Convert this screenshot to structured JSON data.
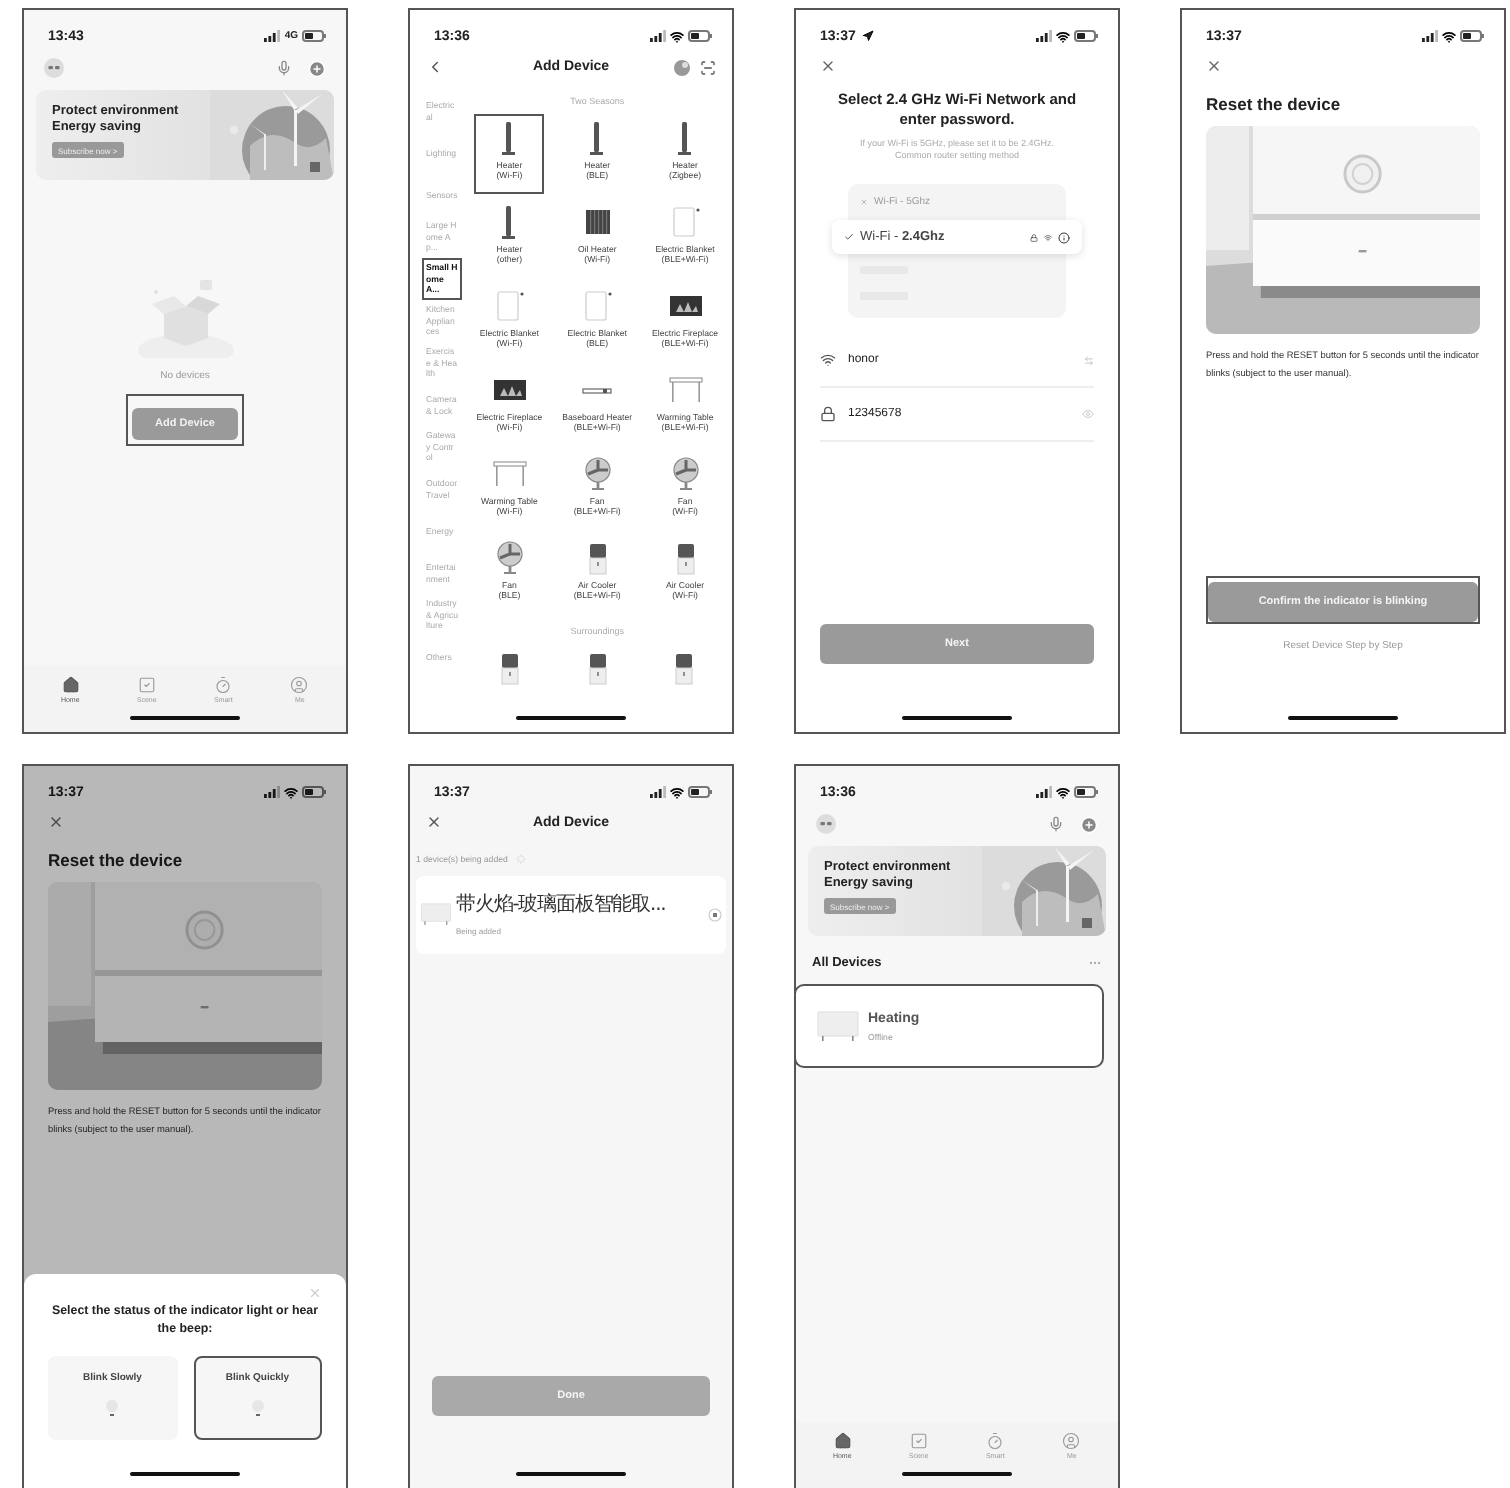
{
  "screens": [
    {
      "kind": "home_empty",
      "time": "13:43",
      "network": "4G",
      "banner": {
        "title": "Protect environment",
        "subtitle": "Energy saving",
        "button": "Subscribe now >"
      },
      "empty_text": "No devices",
      "add_button": {
        "label": "Add Device",
        "highlighted": true
      },
      "tabs": [
        {
          "label": "Home",
          "selected": true
        },
        {
          "label": "Scene",
          "selected": false
        },
        {
          "label": "Smart",
          "selected": false
        },
        {
          "label": "Me",
          "selected": false
        }
      ]
    },
    {
      "kind": "catalog",
      "time": "13:36",
      "title": "Add Device",
      "categories": [
        {
          "label": "Electrical",
          "selected": false
        },
        {
          "label": "Lighting",
          "selected": false
        },
        {
          "label": "Sensors",
          "selected": false
        },
        {
          "label": "Large Home Ap...",
          "selected": false
        },
        {
          "label": "Small Home A...",
          "selected": true
        },
        {
          "label": "Kitchen Appliances",
          "selected": false
        },
        {
          "label": "Exercise & Health",
          "selected": false
        },
        {
          "label": "Camera & Lock",
          "selected": false
        },
        {
          "label": "Gateway Control",
          "selected": false
        },
        {
          "label": "Outdoor Travel",
          "selected": false
        },
        {
          "label": "Energy",
          "selected": false
        },
        {
          "label": "Entertainment",
          "selected": false
        },
        {
          "label": "Industry & Agriculture",
          "selected": false
        },
        {
          "label": "Others",
          "selected": false
        }
      ],
      "sections": [
        {
          "heading": "Two Seasons",
          "items": [
            {
              "name": "Heater",
              "protocol": "(Wi-Fi)",
              "kind": "tower",
              "highlighted": true
            },
            {
              "name": "Heater",
              "protocol": "(BLE)",
              "kind": "tower",
              "highlighted": false
            },
            {
              "name": "Heater",
              "protocol": "(Zigbee)",
              "kind": "tower",
              "highlighted": false
            },
            {
              "name": "Heater",
              "protocol": "(other)",
              "kind": "tower",
              "highlighted": false
            },
            {
              "name": "Oil Heater",
              "protocol": "(Wi-Fi)",
              "kind": "radiator",
              "highlighted": false
            },
            {
              "name": "Electric Blanket",
              "protocol": "(BLE+Wi-Fi)",
              "kind": "blanket",
              "highlighted": false
            },
            {
              "name": "Electric Blanket",
              "protocol": "(Wi-Fi)",
              "kind": "blanket",
              "highlighted": false
            },
            {
              "name": "Electric Blanket",
              "protocol": "(BLE)",
              "kind": "blanket",
              "highlighted": false
            },
            {
              "name": "Electric Fireplace",
              "protocol": "(BLE+Wi-Fi)",
              "kind": "fireplace",
              "highlighted": false
            },
            {
              "name": "Electric Fireplace",
              "protocol": "(Wi-Fi)",
              "kind": "fireplace",
              "highlighted": false
            },
            {
              "name": "Baseboard Heater",
              "protocol": "(BLE+Wi-Fi)",
              "kind": "baseboard",
              "highlighted": false
            },
            {
              "name": "Warming Table",
              "protocol": "(BLE+Wi-Fi)",
              "kind": "table",
              "highlighted": false
            },
            {
              "name": "Warming Table",
              "protocol": "(Wi-Fi)",
              "kind": "table",
              "highlighted": false
            },
            {
              "name": "Fan",
              "protocol": "(BLE+Wi-Fi)",
              "kind": "fan",
              "highlighted": false
            },
            {
              "name": "Fan",
              "protocol": "(Wi-Fi)",
              "kind": "fan",
              "highlighted": false
            },
            {
              "name": "Fan",
              "protocol": "(BLE)",
              "kind": "fan",
              "highlighted": false
            },
            {
              "name": "Air Cooler",
              "protocol": "(BLE+Wi-Fi)",
              "kind": "cooler",
              "highlighted": false
            },
            {
              "name": "Air Cooler",
              "protocol": "(Wi-Fi)",
              "kind": "cooler",
              "highlighted": false
            }
          ]
        },
        {
          "heading": "Surroundings",
          "items": [
            {
              "kind": "cooler",
              "highlighted": false
            },
            {
              "kind": "cooler",
              "highlighted": false
            },
            {
              "kind": "cooler",
              "highlighted": false
            }
          ]
        }
      ]
    },
    {
      "kind": "wifi",
      "time": "13:37",
      "location": true,
      "title": "Select 2.4 GHz Wi-Fi Network and enter password.",
      "hint": "If your Wi-Fi is 5GHz, please set it to be 2.4GHz.",
      "link": "Common router setting method",
      "networks": [
        {
          "label": "Wi-Fi - 5Ghz",
          "selected": false
        },
        {
          "label": "Wi-Fi - **2.4Ghz**",
          "selected": true
        }
      ],
      "ssid": "honor",
      "password": "12345678",
      "button": "Next"
    },
    {
      "kind": "reset",
      "time": "13:37",
      "title": "Reset the device",
      "instruction": "Press and hold the RESET button for 5 seconds until the indicator blinks (subject to the user manual).",
      "button": {
        "label": "Confirm the indicator is blinking",
        "highlighted": true
      },
      "link": "Reset Device Step by Step"
    },
    {
      "kind": "reset_sheet",
      "time": "13:37",
      "title": "Reset the device",
      "instruction": "Press and hold the RESET button for 5 seconds until the indicator blinks (subject to the user manual).",
      "sheet_title": "Select the status of the indicator light or hear the beep:",
      "options": [
        {
          "label": "Blink Slowly",
          "selected": false
        },
        {
          "label": "Blink Quickly",
          "selected": true
        }
      ]
    },
    {
      "kind": "adding",
      "time": "13:37",
      "title": "Add Device",
      "status": "1 device(s) being added",
      "device": {
        "name": "带火焰-玻璃面板智能取...",
        "status": "Being added"
      },
      "button": {
        "label": "Done",
        "disabled": true
      }
    },
    {
      "kind": "home_devices",
      "time": "13:36",
      "banner": {
        "title": "Protect environment",
        "subtitle": "Energy saving",
        "button": "Subscribe now >"
      },
      "section": "All Devices",
      "device": {
        "name": "Heating",
        "status": "Offline",
        "highlighted": true
      },
      "tabs": [
        {
          "label": "Home",
          "selected": true
        },
        {
          "label": "Scene",
          "selected": false
        },
        {
          "label": "Smart",
          "selected": false
        },
        {
          "label": "Me",
          "selected": false
        }
      ]
    }
  ]
}
